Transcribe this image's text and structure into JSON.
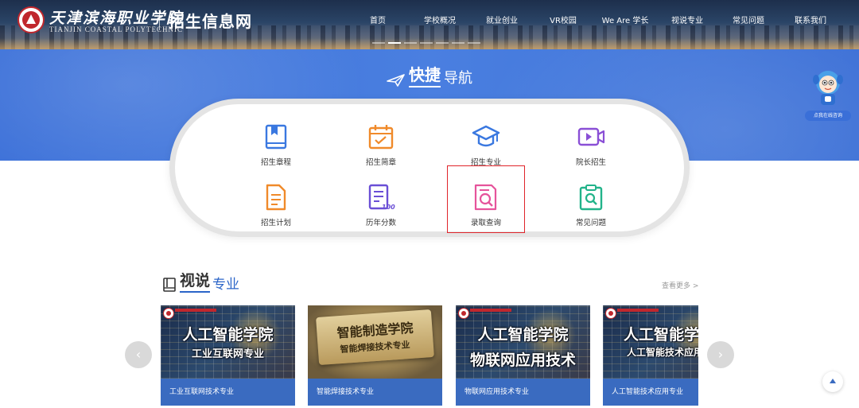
{
  "header": {
    "school_name_cn": "天津滨海职业学院",
    "school_name_en": "TIANJIN COASTAL POLYTECHNIC",
    "site_title": "招生信息网",
    "nav": [
      "首页",
      "学校概况",
      "就业创业",
      "VR校园",
      "We Are 学长",
      "视说专业",
      "常见问题",
      "联系我们"
    ]
  },
  "quick_nav": {
    "title_strong": "快捷",
    "title_light": "导航",
    "items": [
      {
        "label": "招生章程",
        "icon": "book-icon",
        "color": "#3a78e0"
      },
      {
        "label": "招生简章",
        "icon": "calendar-check-icon",
        "color": "#f08a2a"
      },
      {
        "label": "招生专业",
        "icon": "graduation-cap-icon",
        "color": "#3a78e0"
      },
      {
        "label": "院长招生",
        "icon": "video-camera-icon",
        "color": "#8a4fd6"
      },
      {
        "label": "招生计划",
        "icon": "document-icon",
        "color": "#f08a2a"
      },
      {
        "label": "历年分数",
        "icon": "score-list-icon",
        "color": "#6a4fd6"
      },
      {
        "label": "录取查询",
        "icon": "search-document-icon",
        "color": "#e6539b"
      },
      {
        "label": "常见问题",
        "icon": "clipboard-search-icon",
        "color": "#22b38a"
      }
    ],
    "selected_label": "录取查询"
  },
  "mascot": {
    "pill": "点我在线咨询"
  },
  "video_majors": {
    "title_strong": "视说",
    "title_light": "专业",
    "more": "查看更多 >",
    "cards": [
      {
        "caption": "工业互联网技术专业",
        "line1": "人工智能学院",
        "line2": "工业互联网专业"
      },
      {
        "caption": "智能焊接技术专业",
        "line1": "智能制造学院",
        "line2": "智能焊接技术专业"
      },
      {
        "caption": "物联网应用技术专业",
        "line1": "人工智能学院",
        "line2": "物联网应用技术"
      },
      {
        "caption": "人工智能技术应用专业",
        "line1": "人工智能学",
        "line2": "人工智能技术应用"
      }
    ],
    "prev": "‹",
    "next": "›"
  }
}
